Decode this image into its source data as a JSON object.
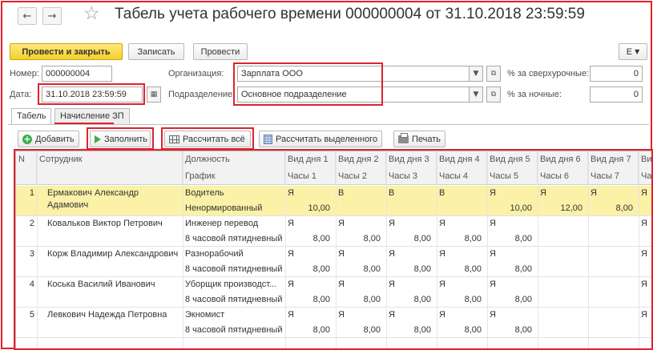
{
  "header": {
    "title": "Табель учета рабочего времени 000000004 от 31.10.2018 23:59:59",
    "back_glyph": "←",
    "forward_glyph": "→",
    "star_glyph": "☆"
  },
  "commands": {
    "post_close": "Провести и закрыть",
    "save": "Записать",
    "post": "Провести",
    "more": "Е"
  },
  "form": {
    "number_label": "Номер:",
    "number_value": "000000004",
    "date_label": "Дата:",
    "date_value": "31.10.2018 23:59:59",
    "org_label": "Организация:",
    "org_value": "Зарплата ООО",
    "dept_label": "Подразделение:",
    "dept_value": "Основное подразделение",
    "overtime_label": "% за сверхурочные:",
    "overtime_value": "0",
    "night_label": "% за ночные:",
    "night_value": "0"
  },
  "tabs": [
    "Табель",
    "Начисление ЗП"
  ],
  "toolbar": {
    "add": "Добавить",
    "fill": "Заполнить",
    "calc_all": "Рассчитать всё",
    "calc_selected": "Рассчитать выделенного",
    "print": "Печать"
  },
  "table": {
    "headers": {
      "n": "N",
      "employee": "Сотрудник",
      "position": "Должность",
      "schedule": "График",
      "day_types": [
        "Вид дня 1",
        "Вид дня 2",
        "Вид дня 3",
        "Вид дня 4",
        "Вид дня 5",
        "Вид дня 6",
        "Вид дня 7",
        "Вид"
      ],
      "hours": [
        "Часы 1",
        "Часы 2",
        "Часы 3",
        "Часы 4",
        "Часы 5",
        "Часы 6",
        "Часы 7",
        "Час"
      ]
    },
    "rows": [
      {
        "n": "1",
        "employee": [
          "Ермакович Александр",
          "Адамович"
        ],
        "position": "Водитель",
        "schedule": "Ненормированный",
        "types": [
          "Я",
          "В",
          "В",
          "В",
          "Я",
          "Я",
          "Я",
          "Я"
        ],
        "hours": [
          "10,00",
          "",
          "",
          "",
          "10,00",
          "12,00",
          "8,00",
          ""
        ]
      },
      {
        "n": "2",
        "employee": [
          "Ковальков Виктор Петрович",
          ""
        ],
        "position": "Инженер перевод",
        "schedule": "8 часовой пятидневный",
        "types": [
          "Я",
          "Я",
          "Я",
          "Я",
          "Я",
          "",
          "",
          "Я"
        ],
        "hours": [
          "8,00",
          "8,00",
          "8,00",
          "8,00",
          "8,00",
          "",
          "",
          ""
        ]
      },
      {
        "n": "3",
        "employee": [
          "Корж Владимир Александрович",
          ""
        ],
        "position": "Разнорабочий",
        "schedule": "8 часовой пятидневный",
        "types": [
          "Я",
          "Я",
          "Я",
          "Я",
          "Я",
          "",
          "",
          "Я"
        ],
        "hours": [
          "8,00",
          "8,00",
          "8,00",
          "8,00",
          "8,00",
          "",
          "",
          ""
        ]
      },
      {
        "n": "4",
        "employee": [
          "Коська Василий Иванович",
          ""
        ],
        "position": "Уборщик производст...",
        "schedule": "8 часовой пятидневный",
        "types": [
          "Я",
          "Я",
          "Я",
          "Я",
          "Я",
          "",
          "",
          "Я"
        ],
        "hours": [
          "8,00",
          "8,00",
          "8,00",
          "8,00",
          "8,00",
          "",
          "",
          ""
        ]
      },
      {
        "n": "5",
        "employee": [
          "Левкович Надежда Петровна",
          ""
        ],
        "position": "Экномист",
        "schedule": "8 часовой пятидневный",
        "types": [
          "Я",
          "Я",
          "Я",
          "Я",
          "Я",
          "",
          "",
          "Я"
        ],
        "hours": [
          "8,00",
          "8,00",
          "8,00",
          "8,00",
          "8,00",
          "",
          "",
          ""
        ]
      }
    ]
  }
}
